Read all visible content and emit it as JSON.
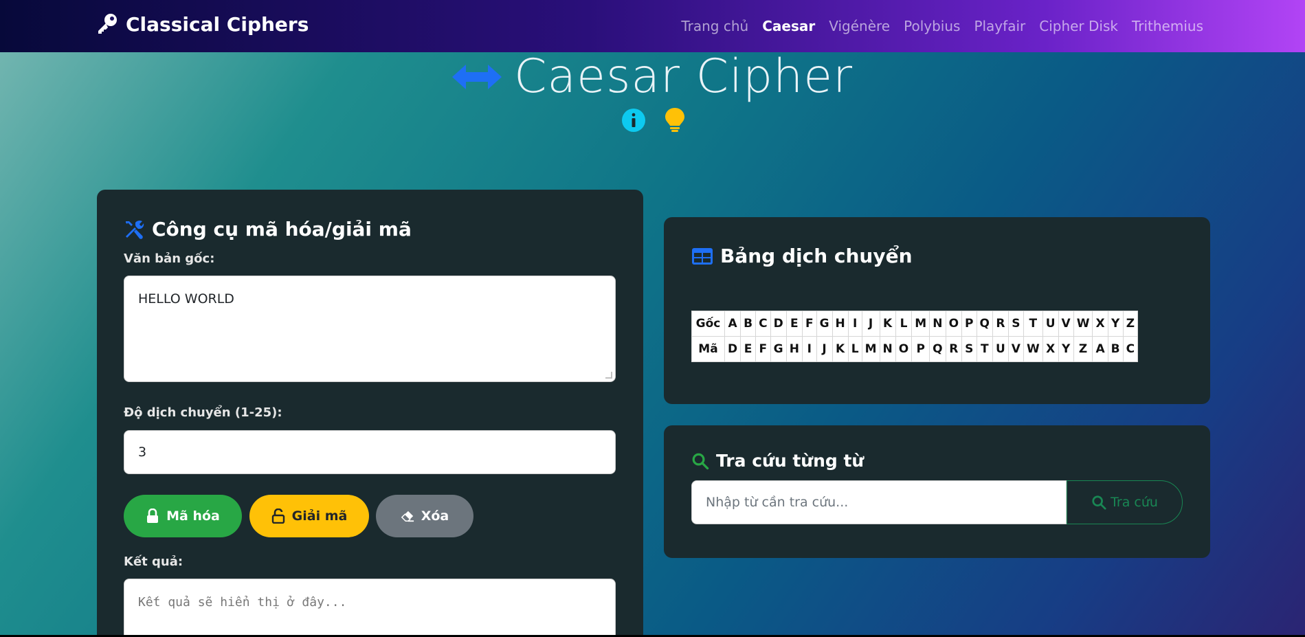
{
  "navbar": {
    "brand": "Classical Ciphers",
    "brand_icon": "key-icon",
    "links": [
      "Trang chủ",
      "Caesar",
      "Vigénère",
      "Polybius",
      "Playfair",
      "Cipher Disk",
      "Trithemius"
    ],
    "active": "Caesar"
  },
  "hero": {
    "title": "Caesar Cipher",
    "icon": "arrows-left-right-icon",
    "info_icon": "info-circle-icon",
    "hint_icon": "lightbulb-icon"
  },
  "tool": {
    "title": "Công cụ mã hóa/giải mã",
    "title_icon": "tools-icon",
    "plaintext_label": "Văn bản gốc:",
    "plaintext_value": "HELLO WORLD",
    "shift_label": "Độ dịch chuyển (1-25):",
    "shift_value": "3",
    "encrypt_label": "Mã hóa",
    "decrypt_label": "Giải mã",
    "clear_label": "Xóa",
    "result_label": "Kết quả:",
    "result_placeholder": "Kết quả sẽ hiển thị ở đây..."
  },
  "shift_table": {
    "title": "Bảng dịch chuyển",
    "title_icon": "table-icon",
    "row_labels": [
      "Gốc",
      "Mã"
    ],
    "plain": [
      "A",
      "B",
      "C",
      "D",
      "E",
      "F",
      "G",
      "H",
      "I",
      "J",
      "K",
      "L",
      "M",
      "N",
      "O",
      "P",
      "Q",
      "R",
      "S",
      "T",
      "U",
      "V",
      "W",
      "X",
      "Y",
      "Z"
    ],
    "cipher": [
      "D",
      "E",
      "F",
      "G",
      "H",
      "I",
      "J",
      "K",
      "L",
      "M",
      "N",
      "O",
      "P",
      "Q",
      "R",
      "S",
      "T",
      "U",
      "V",
      "W",
      "X",
      "Y",
      "Z",
      "A",
      "B",
      "C"
    ]
  },
  "lookup": {
    "title": "Tra cứu từng từ",
    "title_icon": "search-icon",
    "placeholder": "Nhập từ cần tra cứu...",
    "button_label": "Tra cứu"
  },
  "colors": {
    "primary": "#0d6efd",
    "success": "#28a745",
    "warning": "#ffc107",
    "secondary": "#6c757d",
    "info": "#0dcaf0",
    "card_bg": "#1a2a2e"
  }
}
